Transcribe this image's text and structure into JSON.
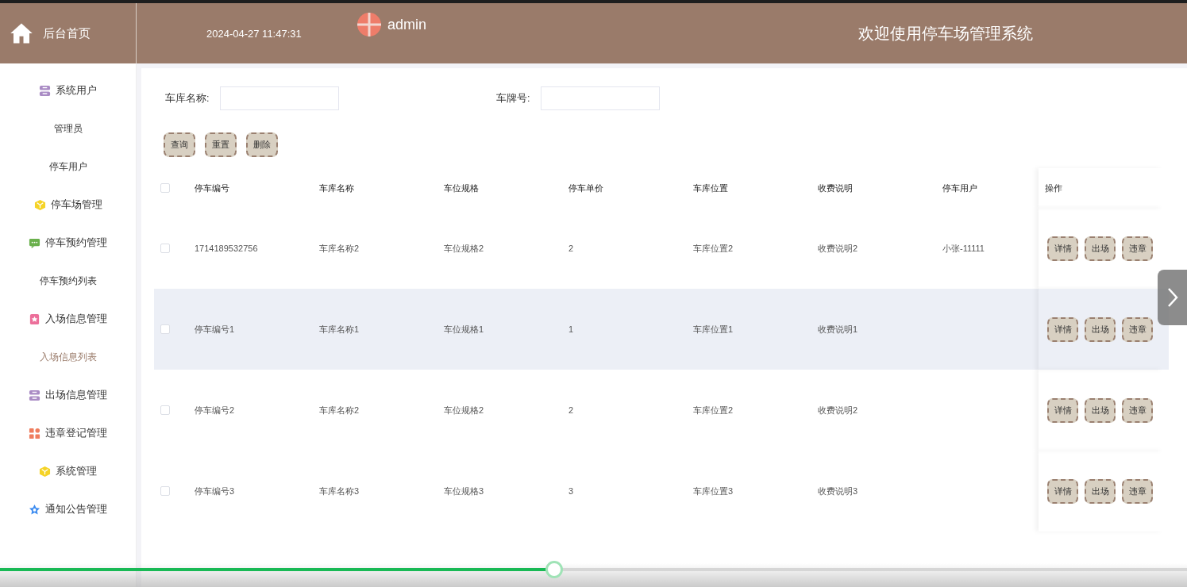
{
  "header": {
    "home_label": "后台首页",
    "datetime": "2024-04-27 11:47:31",
    "user": "admin",
    "title": "欢迎使用停车场管理系统"
  },
  "sidebar": {
    "items": [
      {
        "kind": "group",
        "label": "系统用户",
        "color": "#a98bc4",
        "selected": false,
        "children": [
          {
            "label": "管理员",
            "selected": false
          },
          {
            "label": "停车用户",
            "selected": false
          }
        ]
      },
      {
        "kind": "group",
        "label": "停车场管理",
        "color": "#f5d327",
        "selected": false
      },
      {
        "kind": "group",
        "label": "停车预约管理",
        "color": "#6ab04c",
        "selected": false,
        "children": [
          {
            "label": "停车预约列表",
            "selected": false
          }
        ]
      },
      {
        "kind": "group",
        "label": "入场信息管理",
        "color": "#ec6f9a",
        "selected": false,
        "children": [
          {
            "label": "入场信息列表",
            "selected": true
          }
        ]
      },
      {
        "kind": "group",
        "label": "出场信息管理",
        "color": "#a98bc4",
        "selected": false
      },
      {
        "kind": "group",
        "label": "违章登记管理",
        "color": "#ef7d5e",
        "selected": false
      },
      {
        "kind": "group",
        "label": "系统管理",
        "color": "#f5d327",
        "selected": false
      },
      {
        "kind": "group",
        "label": "通知公告管理",
        "color": "#3d8cf0",
        "selected": false
      }
    ]
  },
  "search": {
    "fields": [
      {
        "label": "车库名称:"
      },
      {
        "label": "车牌号:"
      }
    ],
    "buttons": [
      "查询",
      "重置",
      "删除"
    ]
  },
  "table": {
    "columns": [
      "停车编号",
      "车库名称",
      "车位规格",
      "停车单价",
      "车库位置",
      "收费说明",
      "停车用户"
    ],
    "action_column": "操作",
    "header_checked": false,
    "rows": [
      {
        "checked": false,
        "hovered": false,
        "cells": [
          "1714189532756",
          "车库名称2",
          "车位规格2",
          "2",
          "车库位置2",
          "收费说明2",
          "小张-11111"
        ],
        "actions": [
          "详情",
          "出场",
          "违章"
        ]
      },
      {
        "checked": false,
        "hovered": true,
        "cells": [
          "停车编号1",
          "车库名称1",
          "车位规格1",
          "1",
          "车库位置1",
          "收费说明1",
          null
        ],
        "actions": [
          "详情",
          "出场",
          "违章"
        ]
      },
      {
        "checked": false,
        "hovered": false,
        "cells": [
          "停车编号2",
          "车库名称2",
          "车位规格2",
          "2",
          "车库位置2",
          "收费说明2",
          null
        ],
        "actions": [
          "详情",
          "出场",
          "违章"
        ]
      },
      {
        "checked": false,
        "hovered": false,
        "cells": [
          "停车编号3",
          "车库名称3",
          "车位规格3",
          "3",
          "车库位置3",
          "收费说明3",
          null
        ],
        "actions": [
          "详情",
          "出场",
          "违章"
        ]
      }
    ]
  },
  "video_progress": {
    "level": 0.467
  }
}
